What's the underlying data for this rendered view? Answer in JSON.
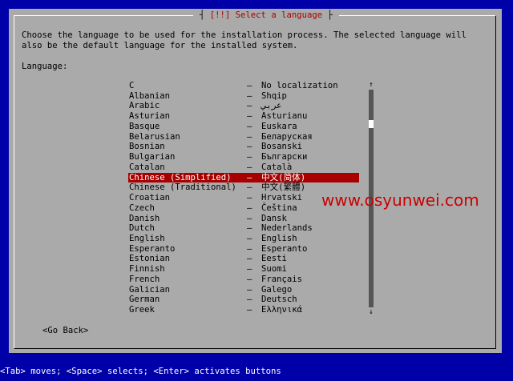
{
  "dialog": {
    "title": "[!!] Select a language",
    "description": "Choose the language to be used for the installation process. The selected language will\nalso be the default language for the installed system.",
    "list_label": "Language:",
    "separator": "–",
    "languages": [
      {
        "name": "C",
        "native": "No localization"
      },
      {
        "name": "Albanian",
        "native": "Shqip"
      },
      {
        "name": "Arabic",
        "native": "عربي"
      },
      {
        "name": "Asturian",
        "native": "Asturianu"
      },
      {
        "name": "Basque",
        "native": "Euskara"
      },
      {
        "name": "Belarusian",
        "native": "Беларуская"
      },
      {
        "name": "Bosnian",
        "native": "Bosanski"
      },
      {
        "name": "Bulgarian",
        "native": "Български"
      },
      {
        "name": "Catalan",
        "native": "Català"
      },
      {
        "name": "Chinese (Simplified)",
        "native": "中文(简体)"
      },
      {
        "name": "Chinese (Traditional)",
        "native": "中文(繁體)"
      },
      {
        "name": "Croatian",
        "native": "Hrvatski"
      },
      {
        "name": "Czech",
        "native": "Čeština"
      },
      {
        "name": "Danish",
        "native": "Dansk"
      },
      {
        "name": "Dutch",
        "native": "Nederlands"
      },
      {
        "name": "English",
        "native": "English"
      },
      {
        "name": "Esperanto",
        "native": "Esperanto"
      },
      {
        "name": "Estonian",
        "native": "Eesti"
      },
      {
        "name": "Finnish",
        "native": "Suomi"
      },
      {
        "name": "French",
        "native": "Français"
      },
      {
        "name": "Galician",
        "native": "Galego"
      },
      {
        "name": "German",
        "native": "Deutsch"
      },
      {
        "name": "Greek",
        "native": "Ελληνικά"
      }
    ],
    "selected": "Chinese (Simplified)",
    "scroll_up": "↑",
    "scroll_down": "↓",
    "go_back": "<Go Back>"
  },
  "watermark": "www.osyunwei.com",
  "hint_bar": "<Tab> moves; <Space> selects; <Enter> activates buttons",
  "colors": {
    "background": "#0000a8",
    "dialog": "#aaaaaa",
    "title": "#a80000",
    "selection": "#a80000",
    "watermark": "#cc0000"
  }
}
